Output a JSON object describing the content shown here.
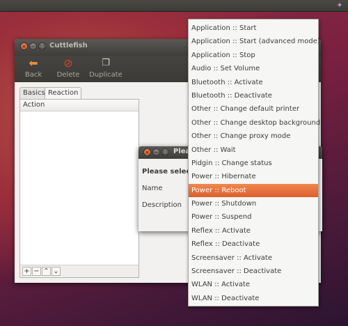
{
  "tray": {
    "icon": "indicator-icon"
  },
  "main_window": {
    "title": "Cuttlefish",
    "toolbar": [
      {
        "label": "Back",
        "icon": "back-arrow-icon"
      },
      {
        "label": "Delete",
        "icon": "delete-icon"
      },
      {
        "label": "Duplicate",
        "icon": "duplicate-icon"
      }
    ],
    "tabs": [
      {
        "label": "Basics",
        "active": false
      },
      {
        "label": "Reaction",
        "active": true
      }
    ],
    "action_list": {
      "header": "Action",
      "toolbar_buttons": [
        "+",
        "−",
        "⌃",
        "⌄"
      ]
    }
  },
  "dialog": {
    "title": "Plea",
    "prompt": "Please select",
    "name_label": "Name",
    "description_label": "Description"
  },
  "menu": {
    "selected": "Power :: Reboot",
    "items": [
      "Application :: Start",
      "Application :: Start (advanced mode)",
      "Application :: Stop",
      "Audio :: Set Volume",
      "Bluetooth :: Activate",
      "Bluetooth :: Deactivate",
      "Other :: Change default printer",
      "Other :: Change desktop background",
      "Other :: Change proxy mode",
      "Other :: Wait",
      "Pidgin :: Change status",
      "Power :: Hibernate",
      "Power :: Reboot",
      "Power :: Shutdown",
      "Power :: Suspend",
      "Reflex :: Activate",
      "Reflex :: Deactivate",
      "Screensaver :: Activate",
      "Screensaver :: Deactivate",
      "WLAN :: Activate",
      "WLAN :: Deactivate"
    ]
  },
  "colors": {
    "accent": "#dd5e2b",
    "titlebar": "#3e3d39",
    "panel_bg": "#f2f1f0"
  }
}
